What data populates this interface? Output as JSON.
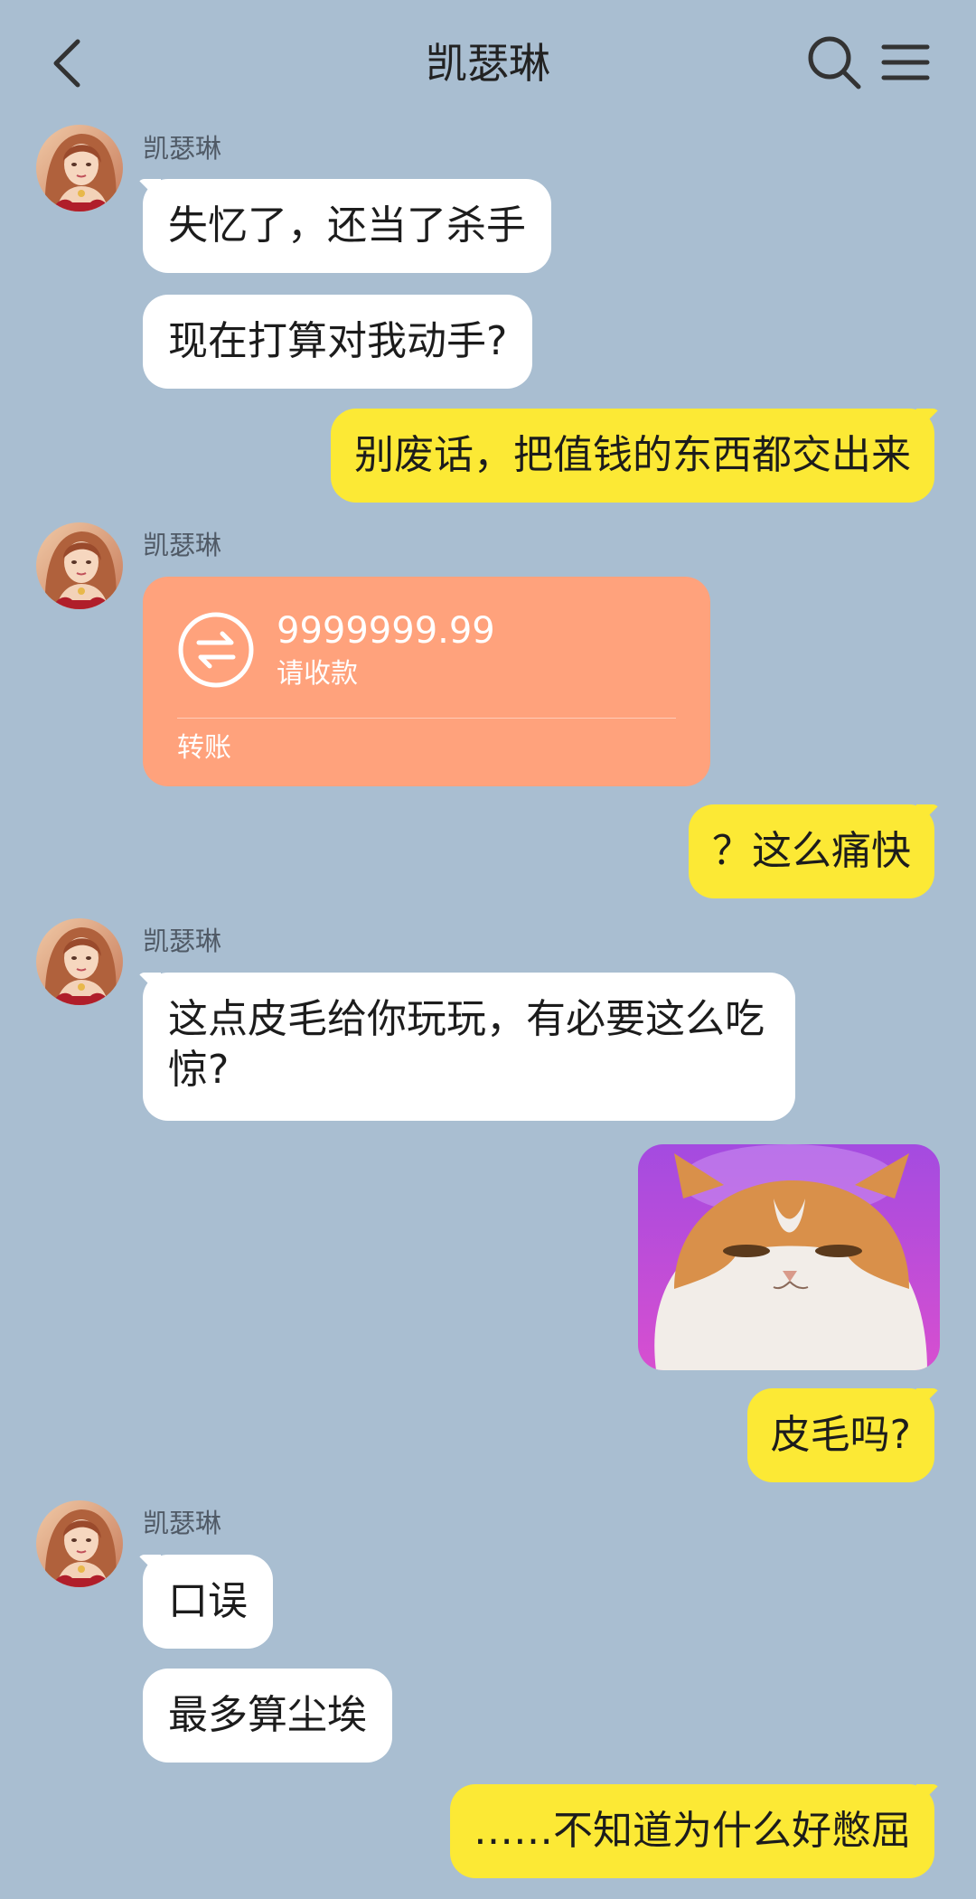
{
  "header": {
    "title": "凯瑟琳",
    "back_icon": "chevron-left-icon",
    "search_icon": "search-icon",
    "menu_icon": "menu-icon"
  },
  "messages": {
    "sender_name": "凯瑟琳",
    "m1": "失忆了，还当了杀手",
    "m2": "现在打算对我动手?",
    "m3": "别废话，把值钱的东西都交出来",
    "transfer": {
      "amount": "9999999.99",
      "status": "请收款",
      "label": "转账",
      "icon": "transfer-arrows-icon"
    },
    "m4": "？这么痛快",
    "m5": "这点皮毛给你玩玩，有必要这么吃惊?",
    "sticker": "cat-sticker",
    "m6": "皮毛吗?",
    "m7": "口误",
    "m8": "最多算尘埃",
    "m9": "……不知道为什么好憋屈"
  },
  "colors": {
    "background": "#a9bed1",
    "incoming_bubble": "#ffffff",
    "outgoing_bubble": "#fce935",
    "transfer_card": "#ffa27c"
  }
}
